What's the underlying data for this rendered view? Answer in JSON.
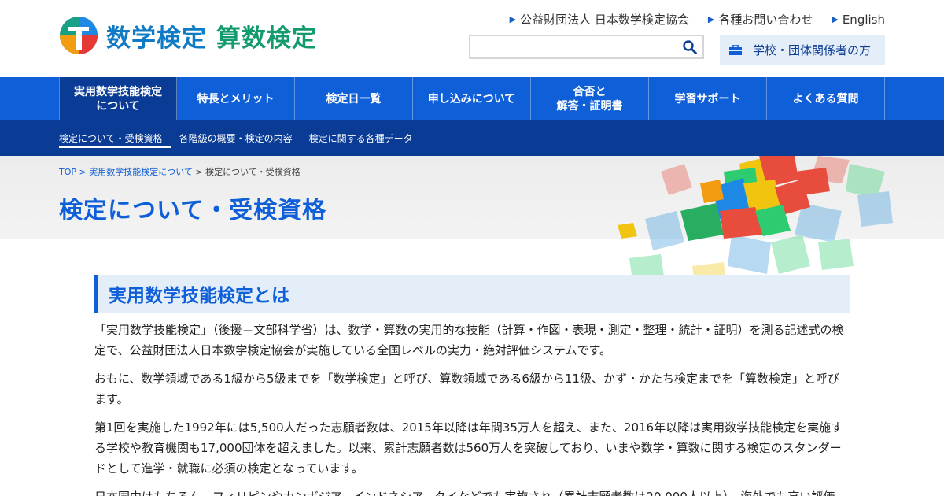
{
  "header": {
    "logo": {
      "part1": "数学検定",
      "part2": "算数検定"
    },
    "toplinks": [
      {
        "label": "公益財団法人 日本数学検定協会"
      },
      {
        "label": "各種お問い合わせ"
      },
      {
        "label": "English"
      }
    ],
    "search": {
      "value": "",
      "placeholder": ""
    },
    "school_button": {
      "label": "学校・団体関係者の方"
    }
  },
  "mainnav": [
    {
      "label": "実用数学技能検定\nについて"
    },
    {
      "label": "特長とメリット"
    },
    {
      "label": "検定日一覧"
    },
    {
      "label": "申し込みについて"
    },
    {
      "label": "合否と\n解答・証明書"
    },
    {
      "label": "学習サポート"
    },
    {
      "label": "よくある質問"
    }
  ],
  "subnav": [
    {
      "label": "検定について・受検資格"
    },
    {
      "label": "各階級の概要・検定の内容"
    },
    {
      "label": "検定に関する各種データ"
    }
  ],
  "breadcrumb": {
    "top": "TOP",
    "parent": "> 実用数学技能検定について",
    "current": "> 検定について・受検資格"
  },
  "page_title": "検定について・受検資格",
  "section": {
    "heading": "実用数学技能検定とは",
    "paragraphs": [
      "「実用数学技能検定」（後援＝文部科学省）は、数学・算数の実用的な技能（計算・作図・表現・測定・整理・統計・証明）を測る記述式の検定で、公益財団法人日本数学検定協会が実施している全国レベルの実力・絶対評価システムです。",
      "おもに、数学領域である1級から5級までを「数学検定」と呼び、算数領域である6級から11級、かず・かたち検定までを「算数検定」と呼びます。",
      "第1回を実施した1992年には5,500人だった志願者数は、2015年以降は年間35万人を超え、また、2016年以降は実用数学技能検定を実施する学校や教育機関も17,000団体を超えました。以来、累計志願者数は560万人を突破しており、いまや数学・算数に関する検定のスタンダードとして進学・就職に必須の検定となっています。",
      "日本国内はもちろん、フィリピンやカンボジア、インドネシア、タイなどでも実施され（累計志願者数は20,000人以上）、海外でも高い評価"
    ]
  },
  "colors": {
    "primary": "#0f5fd8",
    "dark": "#0a3c96",
    "light": "#e4eef9"
  }
}
